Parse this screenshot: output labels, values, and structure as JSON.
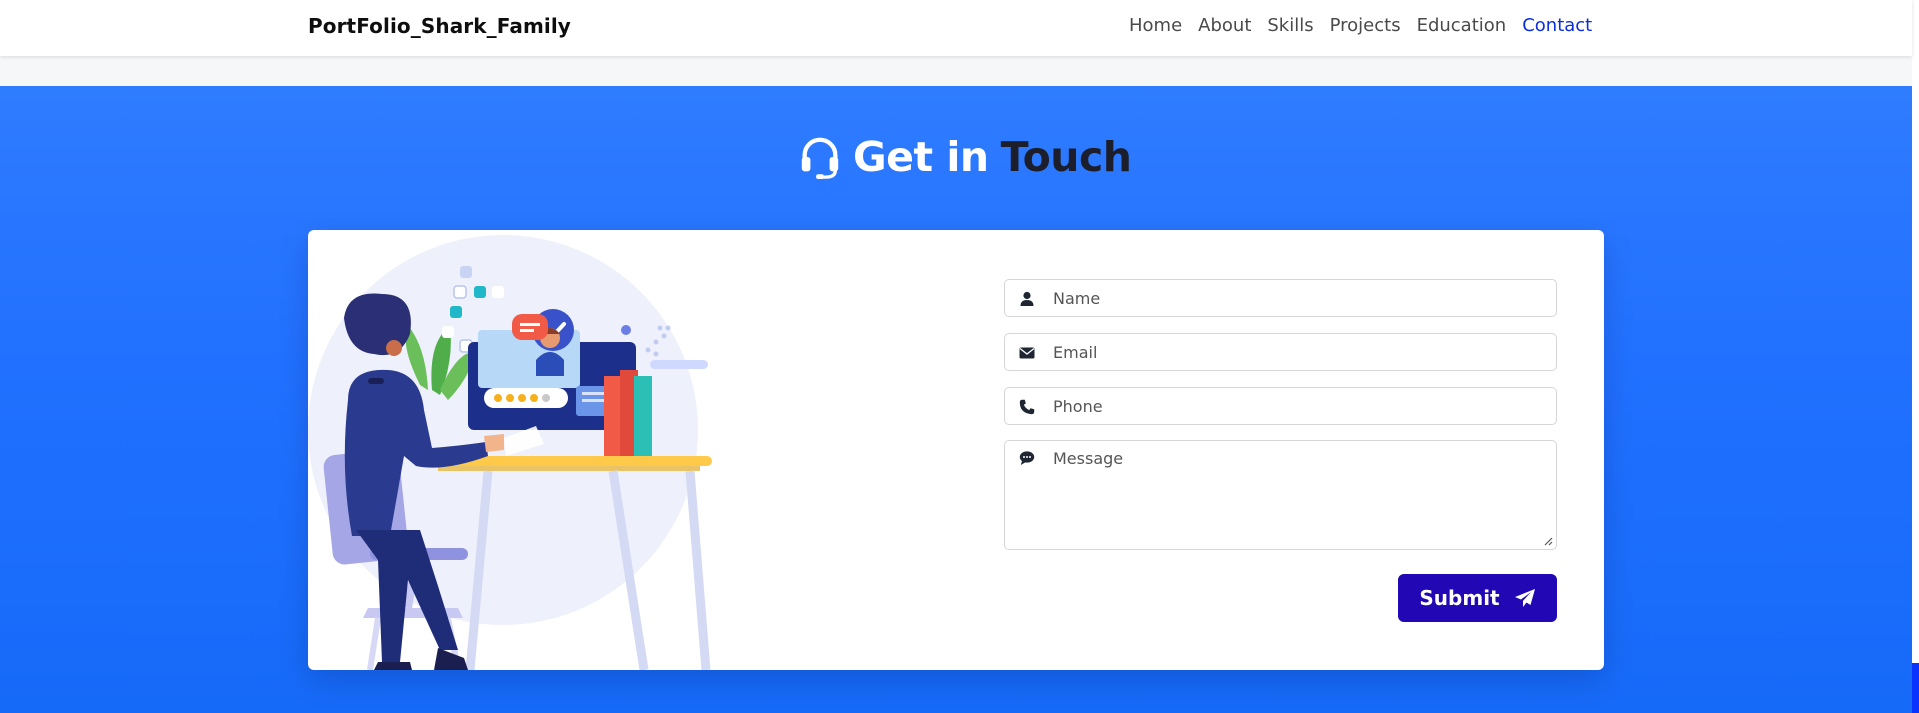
{
  "nav": {
    "brand": "PortFolio_Shark_Family",
    "links": [
      "Home",
      "About",
      "Skills",
      "Projects",
      "Education",
      "Contact"
    ],
    "active": "Contact"
  },
  "contact": {
    "title": "Get in",
    "title_accent": "Touch",
    "fields": {
      "name_placeholder": "Name",
      "email_placeholder": "Email",
      "phone_placeholder": "Phone",
      "message_placeholder": "Message"
    },
    "submit_label": "Submit"
  },
  "colors": {
    "background": "#2170ff",
    "submit": "#2108b4",
    "active_link": "#0b2fdb"
  },
  "icons": {
    "heading": "headset-icon",
    "name": "user-icon",
    "email": "envelope-icon",
    "phone": "phone-icon",
    "message": "comment-icon",
    "submit": "paper-plane-icon"
  }
}
